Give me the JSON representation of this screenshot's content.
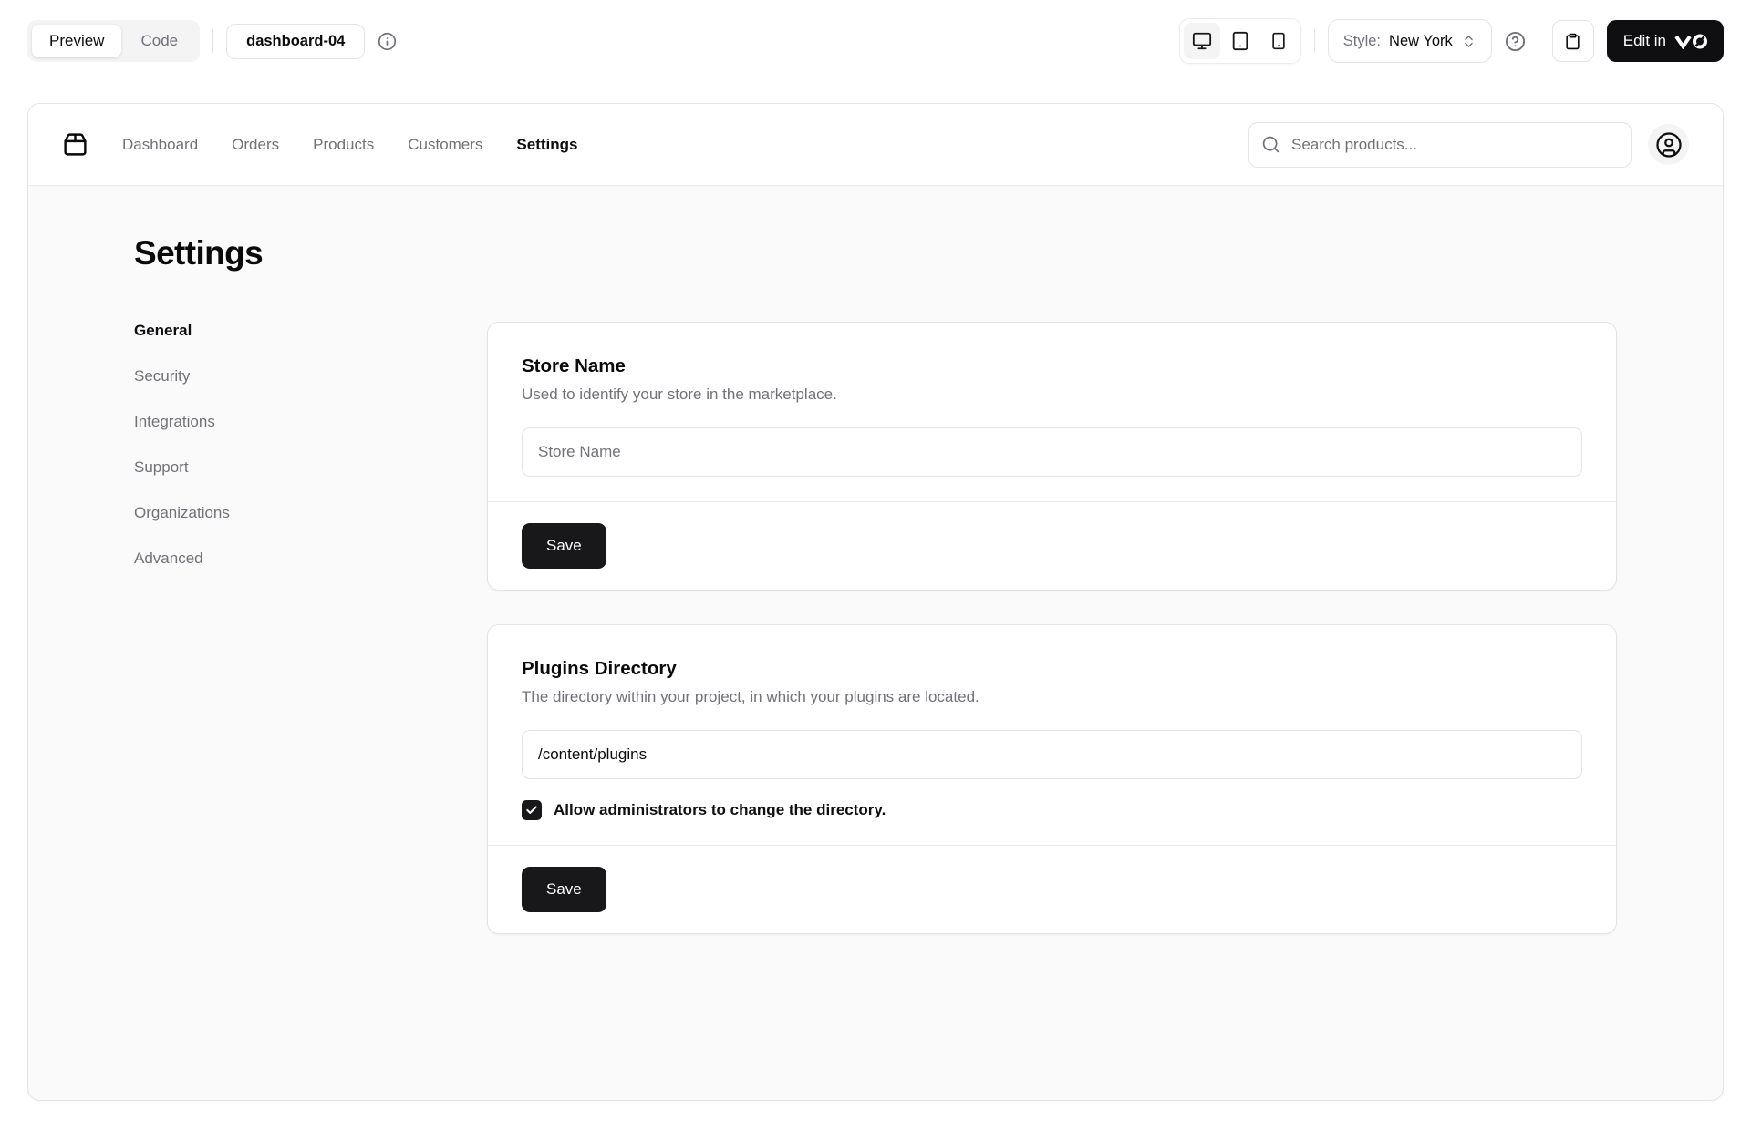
{
  "toolbar": {
    "view_tabs": [
      {
        "label": "Preview"
      },
      {
        "label": "Code"
      }
    ],
    "block_name": "dashboard-04",
    "style": {
      "label": "Style:",
      "value": "New York"
    },
    "edit_button_label": "Edit in"
  },
  "main": {
    "nav": {
      "links": [
        {
          "label": "Dashboard"
        },
        {
          "label": "Orders"
        },
        {
          "label": "Products"
        },
        {
          "label": "Customers"
        },
        {
          "label": "Settings"
        }
      ],
      "search_placeholder": "Search products..."
    },
    "page": {
      "title": "Settings",
      "sidebar": [
        {
          "label": "General"
        },
        {
          "label": "Security"
        },
        {
          "label": "Integrations"
        },
        {
          "label": "Support"
        },
        {
          "label": "Organizations"
        },
        {
          "label": "Advanced"
        }
      ],
      "cards": [
        {
          "title": "Store Name",
          "description": "Used to identify your store in the marketplace.",
          "input_placeholder": "Store Name",
          "save_label": "Save"
        },
        {
          "title": "Plugins Directory",
          "description": "The directory within your project, in which your plugins are located.",
          "input_value": "/content/plugins",
          "checkbox_label": "Allow administrators to change the directory.",
          "save_label": "Save"
        }
      ]
    }
  },
  "colors": {
    "accent_dark": "#18181b",
    "border": "#e4e4e7",
    "muted_bg": "#f4f4f5",
    "content_bg": "#fafafa",
    "text_muted": "#71717a"
  }
}
